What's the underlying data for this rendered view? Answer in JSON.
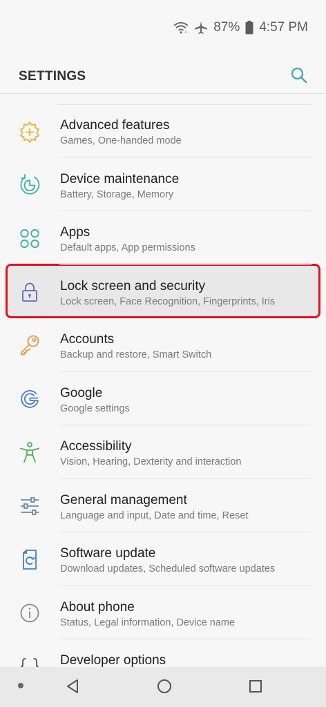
{
  "status_bar": {
    "battery": "87%",
    "time": "4:57 PM"
  },
  "header": {
    "title": "SETTINGS"
  },
  "items": [
    {
      "title": "Advanced features",
      "subtitle": "Games, One-handed mode",
      "icon": "advanced-features-icon",
      "color": "#e8b03b"
    },
    {
      "title": "Device maintenance",
      "subtitle": "Battery, Storage, Memory",
      "icon": "device-maintenance-icon",
      "color": "#3bb3a0"
    },
    {
      "title": "Apps",
      "subtitle": "Default apps, App permissions",
      "icon": "apps-icon",
      "color": "#3ab0a6"
    },
    {
      "title": "Lock screen and security",
      "subtitle": "Lock screen, Face Recognition, Fingerprints, Iris",
      "icon": "lock-icon",
      "color": "#5f6bb8"
    },
    {
      "title": "Accounts",
      "subtitle": "Backup and restore, Smart Switch",
      "icon": "key-icon",
      "color": "#e8964a"
    },
    {
      "title": "Google",
      "subtitle": "Google settings",
      "icon": "google-icon",
      "color": "#4a7bd0"
    },
    {
      "title": "Accessibility",
      "subtitle": "Vision, Hearing, Dexterity and interaction",
      "icon": "accessibility-icon",
      "color": "#4cb05a"
    },
    {
      "title": "General management",
      "subtitle": "Language and input, Date and time, Reset",
      "icon": "sliders-icon",
      "color": "#6a8aa8"
    },
    {
      "title": "Software update",
      "subtitle": "Download updates, Scheduled software updates",
      "icon": "software-update-icon",
      "color": "#3f7fc9"
    },
    {
      "title": "About phone",
      "subtitle": "Status, Legal information, Device name",
      "icon": "info-icon",
      "color": "#8a8a8a"
    },
    {
      "title": "Developer options",
      "subtitle": "",
      "icon": "developer-braces-icon",
      "color": "#555555"
    }
  ],
  "colors": {
    "highlight_border": "#e3101c",
    "search_icon": "#3aa8b8"
  }
}
